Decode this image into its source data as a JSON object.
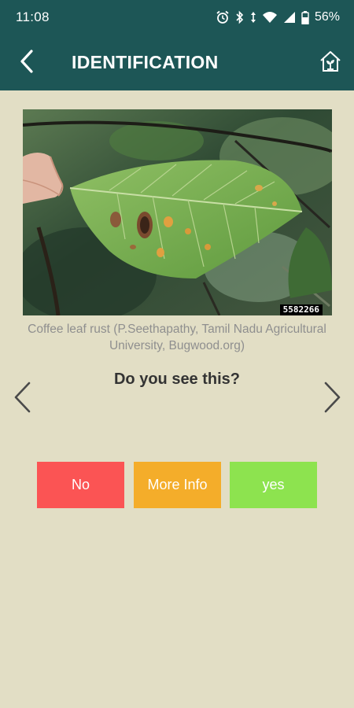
{
  "status_bar": {
    "time": "11:08",
    "battery": "56%",
    "icons": [
      "alarm-icon",
      "bluetooth-icon",
      "data-arrows-icon",
      "wifi-icon",
      "signal-icon",
      "battery-icon"
    ]
  },
  "app_bar": {
    "title": "IDENTIFICATION",
    "back_icon": "chevron-left-icon",
    "home_icon": "home-plant-icon"
  },
  "identification": {
    "image_id": "5582266",
    "caption": "Coffee leaf rust (P.Seethapathy, Tamil Nadu Agricultural University, Bugwood.org)",
    "question": "Do you see this?",
    "prev_icon": "chevron-left-icon",
    "next_icon": "chevron-right-icon"
  },
  "actions": {
    "no_label": "No",
    "more_info_label": "More Info",
    "yes_label": "yes"
  },
  "colors": {
    "header": "#1d5656",
    "background": "#e2dec5",
    "no": "#fb5454",
    "more_info": "#f4ad2a",
    "yes": "#8de34f"
  }
}
